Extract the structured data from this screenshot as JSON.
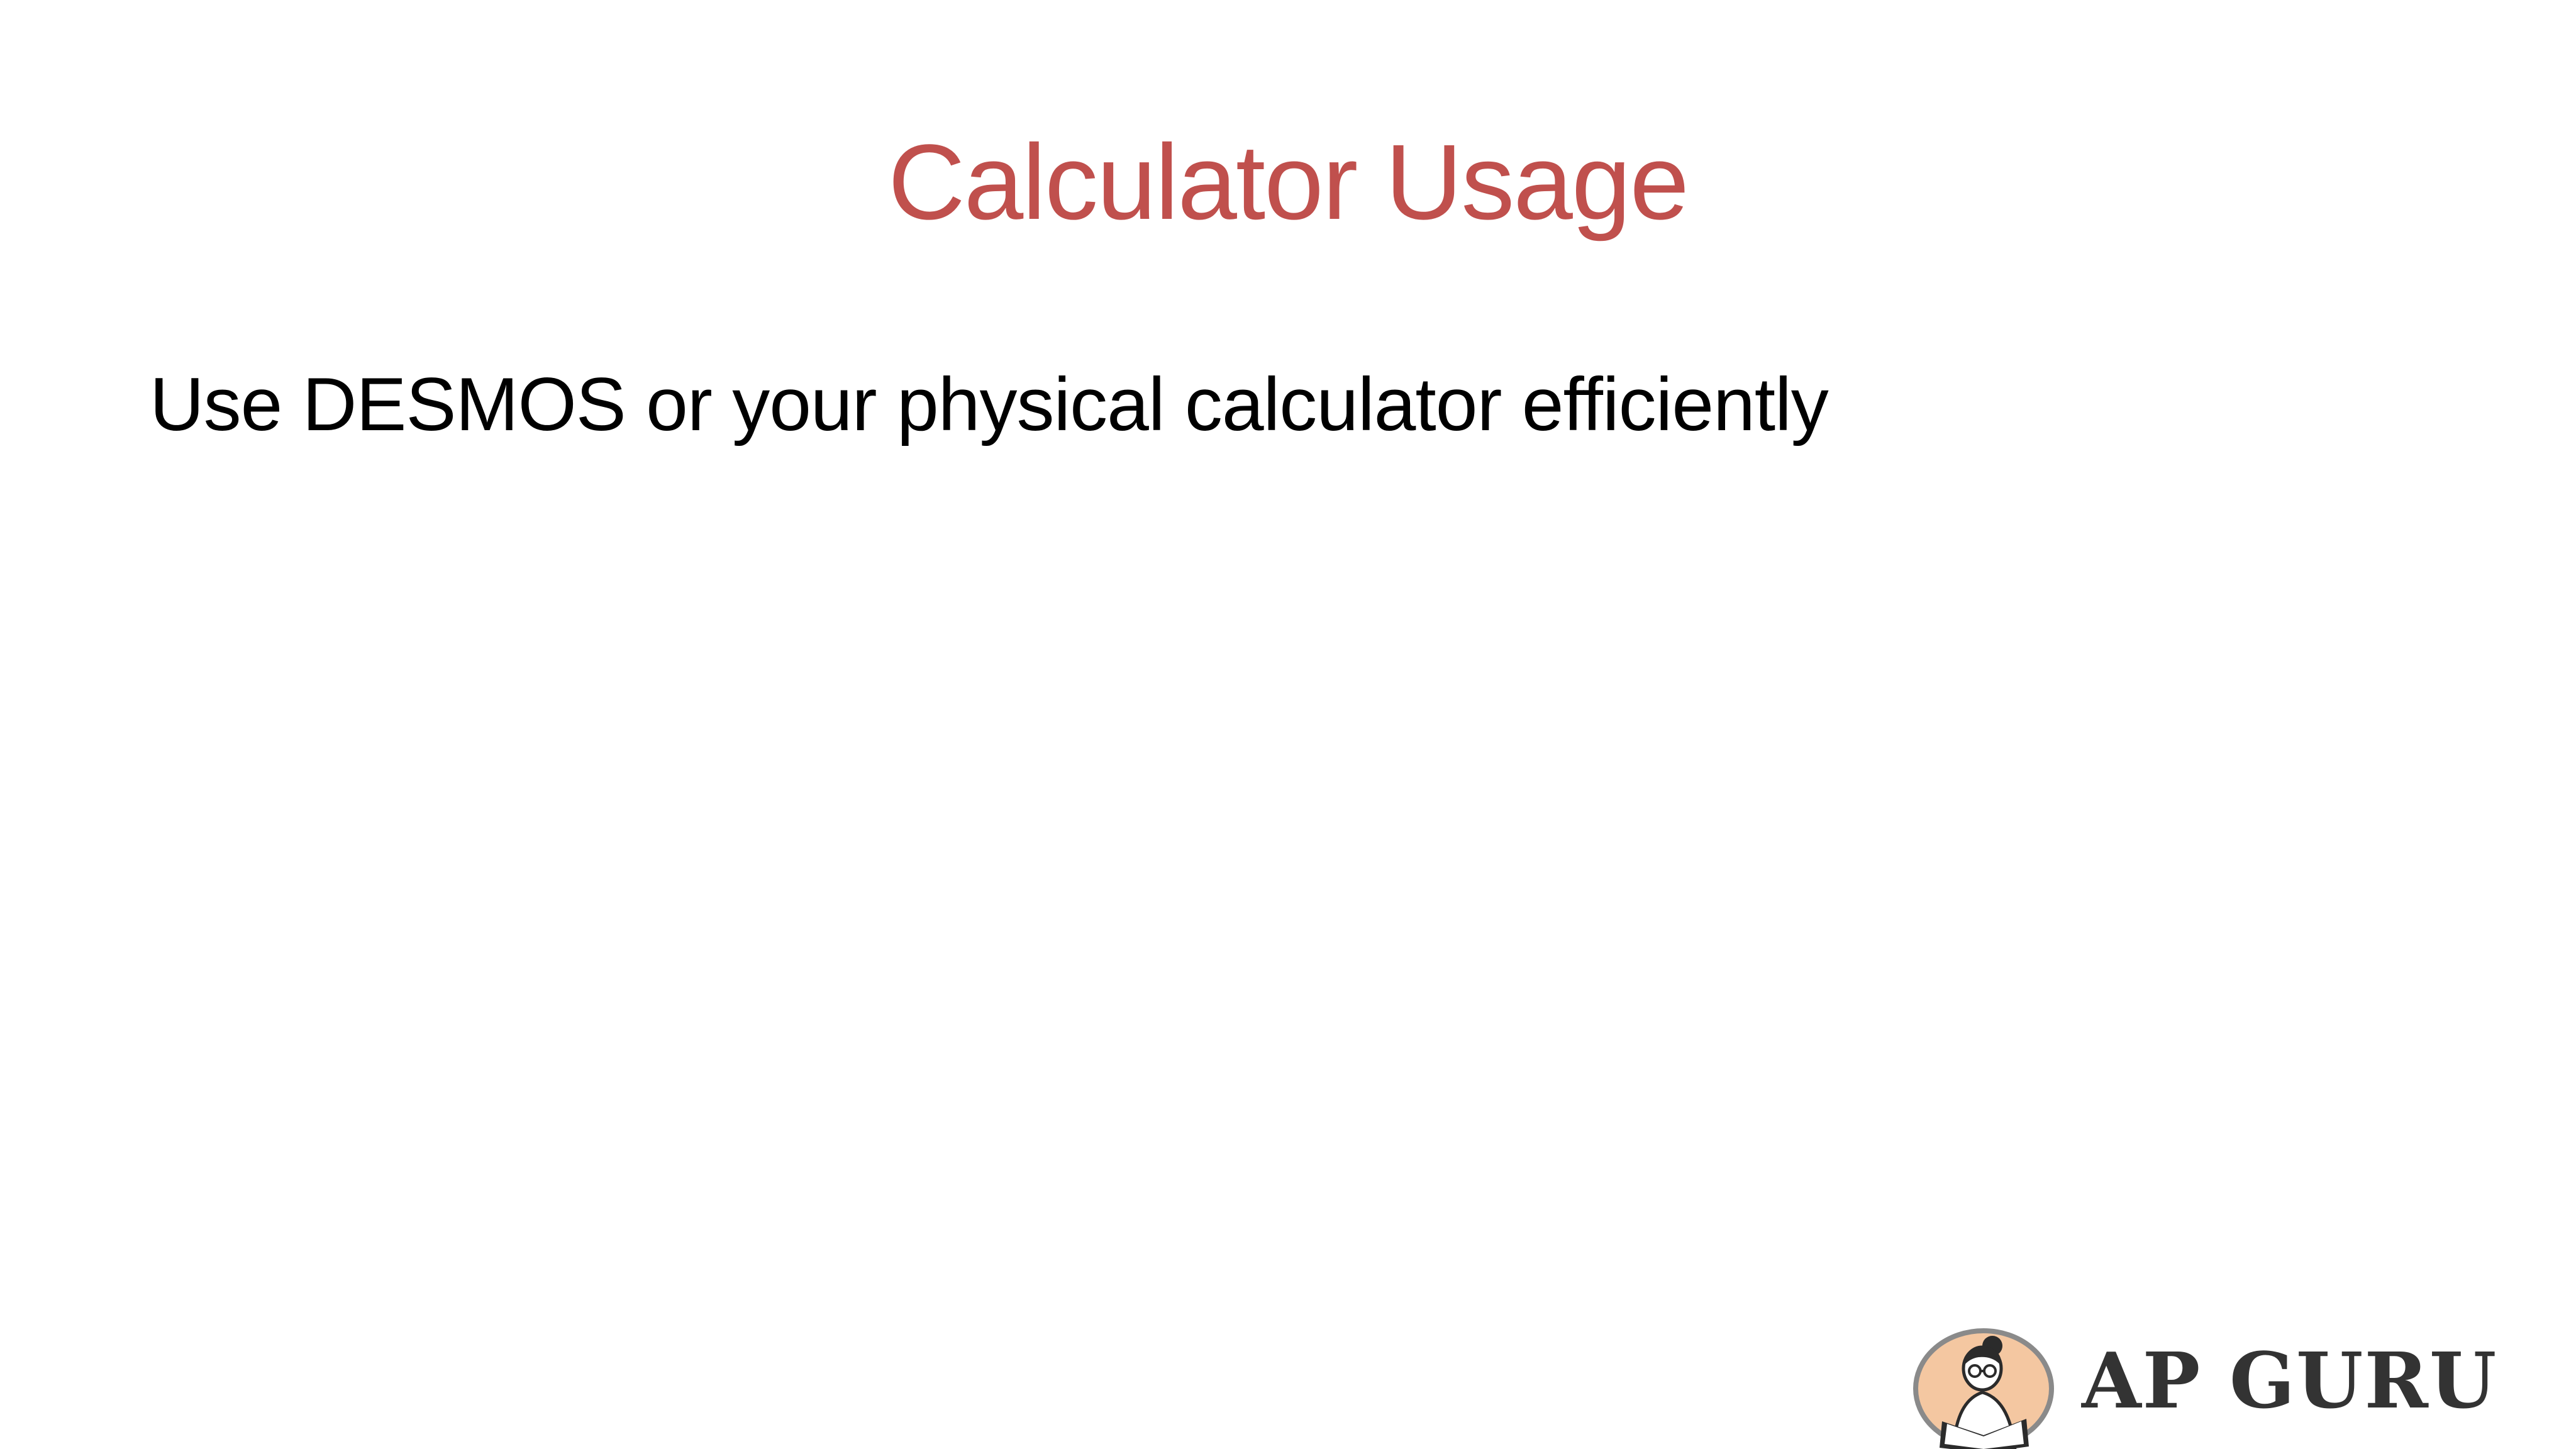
{
  "slide": {
    "title": "Calculator Usage",
    "body": "Use DESMOS or your physical calculator efficiently"
  },
  "logo": {
    "wordmark": "AP GURU",
    "icon": "reading-person-emblem-icon"
  },
  "colors": {
    "title": "#c0504d",
    "body_text": "#000000",
    "logo_text": "#333333",
    "logo_emblem_fill": "#f4c7a1",
    "logo_emblem_ring": "#8a8a8a"
  }
}
